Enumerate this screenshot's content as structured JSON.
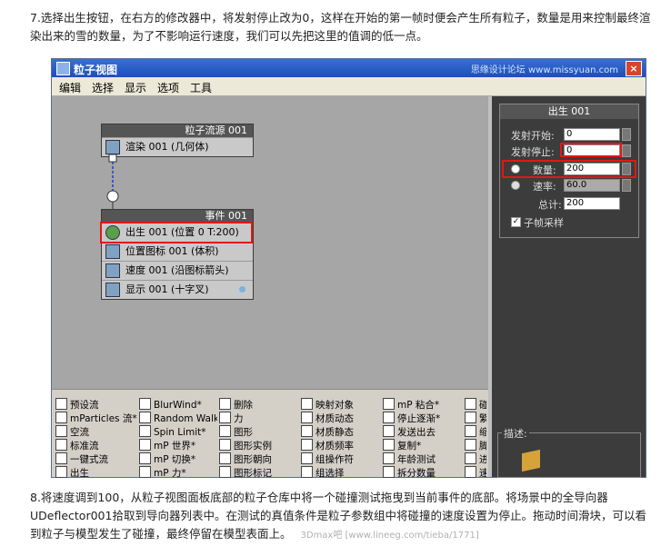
{
  "instructions": {
    "top": "7.选择出生按钮，在右方的修改器中，将发射停止改为0，这样在开始的第一帧时便会产生所有粒子，数量是用来控制最终渲染出来的雪的数量，为了不影响运行速度，我们可以先把这里的值调的低一点。",
    "bottom": "8.将速度调到100，从粒子视图面板底部的粒子仓库中将一个碰撞测试拖曳到当前事件的底部。将场景中的全导向器UDeflector001拾取到导向器列表中。在测试的真值条件是粒子参数组中将碰撞的速度设置为停止。拖动时间滑块，可以看到粒子与模型发生了碰撞，最终停留在模型表面上。"
  },
  "window": {
    "title": "粒子视图",
    "watermark": "思缘设计论坛 www.missyuan.com",
    "close": "×"
  },
  "menu": [
    "编辑",
    "选择",
    "显示",
    "选项",
    "工具"
  ],
  "graph": {
    "source_node": {
      "title": "粒子流源 001",
      "rows": [
        {
          "label": "渲染 001 (几何体)",
          "icon": "render-icon"
        }
      ]
    },
    "event_node": {
      "title": "事件 001",
      "rows": [
        {
          "label": "出生 001 (位置 0 T:200)",
          "icon": "birth-icon"
        },
        {
          "label": "位置图标 001 (体积)",
          "icon": "position-icon"
        },
        {
          "label": "速度 001 (沿图标箭头)",
          "icon": "speed-icon"
        },
        {
          "label": "显示 001 (十字叉)",
          "icon": "display-icon"
        }
      ]
    }
  },
  "panel": {
    "rollout_title": "出生 001",
    "emit_start_label": "发射开始:",
    "emit_start": "0",
    "emit_stop_label": "发射停止:",
    "emit_stop": "0",
    "amount_label": "数量:",
    "amount": "200",
    "rate_label": "速率:",
    "rate": "60.0",
    "total_label": "总计:",
    "total": "200",
    "subframe_label": "子帧采样",
    "desc_label": "描述:"
  },
  "palette": [
    [
      "预设流",
      "mParticles 流*",
      "空流",
      "标准流",
      "一键式流",
      "出生"
    ],
    [
      "BlurWind*",
      "Random Walk*",
      "Spin Limit*",
      "mP 世界*",
      "mP 切换*",
      "mP 力*"
    ],
    [
      "删除",
      "力",
      "图形",
      "图形实例",
      "图形朝向",
      "图形标记"
    ],
    [
      "映射对象",
      "材质动态",
      "材质静态",
      "材质频率",
      "组操作符",
      "组选择"
    ],
    [
      "mP 粘合*",
      "停止逐渐*",
      "发送出去",
      "复制*",
      "年龄测试",
      "拆分数量"
    ],
    [
      "碰",
      "繁",
      "缩",
      "脚",
      "进",
      "速"
    ]
  ],
  "footer_watermark": "3Dmax吧  [www.lineeg.com/tieba/1771]",
  "colors": {
    "highlight": "#e01818",
    "titlebar": "#1c4fb8",
    "panel": "#3c3c3c"
  }
}
